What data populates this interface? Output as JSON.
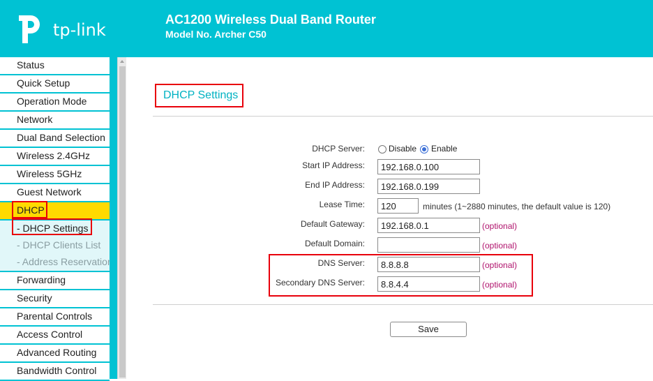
{
  "header": {
    "brand": "tp-link",
    "title": "AC1200 Wireless Dual Band Router",
    "model": "Model No. Archer C50",
    "bg_color": "#00c2d3"
  },
  "sidebar": {
    "items": [
      {
        "label": "Status"
      },
      {
        "label": "Quick Setup"
      },
      {
        "label": "Operation Mode"
      },
      {
        "label": "Network"
      },
      {
        "label": "Dual Band Selection"
      },
      {
        "label": "Wireless 2.4GHz"
      },
      {
        "label": "Wireless 5GHz"
      },
      {
        "label": "Guest Network"
      },
      {
        "label": "DHCP",
        "active": true
      }
    ],
    "dhcp_sub": [
      {
        "label": "- DHCP Settings",
        "current": true
      },
      {
        "label": "- DHCP Clients List"
      },
      {
        "label": "- Address Reservation"
      }
    ],
    "items_after": [
      {
        "label": "Forwarding"
      },
      {
        "label": "Security"
      },
      {
        "label": "Parental Controls"
      },
      {
        "label": "Access Control"
      },
      {
        "label": "Advanced Routing"
      },
      {
        "label": "Bandwidth Control"
      }
    ],
    "active_color": "#ffda00"
  },
  "main": {
    "title": "DHCP Settings",
    "form": {
      "dhcp_server_label": "DHCP Server:",
      "disable_label": "Disable",
      "enable_label": "Enable",
      "selected": "Enable",
      "start_ip_label": "Start IP Address:",
      "start_ip": "192.168.0.100",
      "end_ip_label": "End IP Address:",
      "end_ip": "192.168.0.199",
      "lease_label": "Lease Time:",
      "lease": "120",
      "lease_note": "minutes (1~2880 minutes, the default value is 120)",
      "gateway_label": "Default Gateway:",
      "gateway": "192.168.0.1",
      "domain_label": "Default Domain:",
      "domain": "",
      "dns_label": "DNS Server:",
      "dns": "8.8.8.8",
      "dns2_label": "Secondary DNS Server:",
      "dns2": "8.8.4.4",
      "optional": "(optional)"
    },
    "save_label": "Save"
  },
  "colors": {
    "accent": "#00c2d3",
    "highlight_box": "#e8000b",
    "optional_text": "#b0126c"
  }
}
